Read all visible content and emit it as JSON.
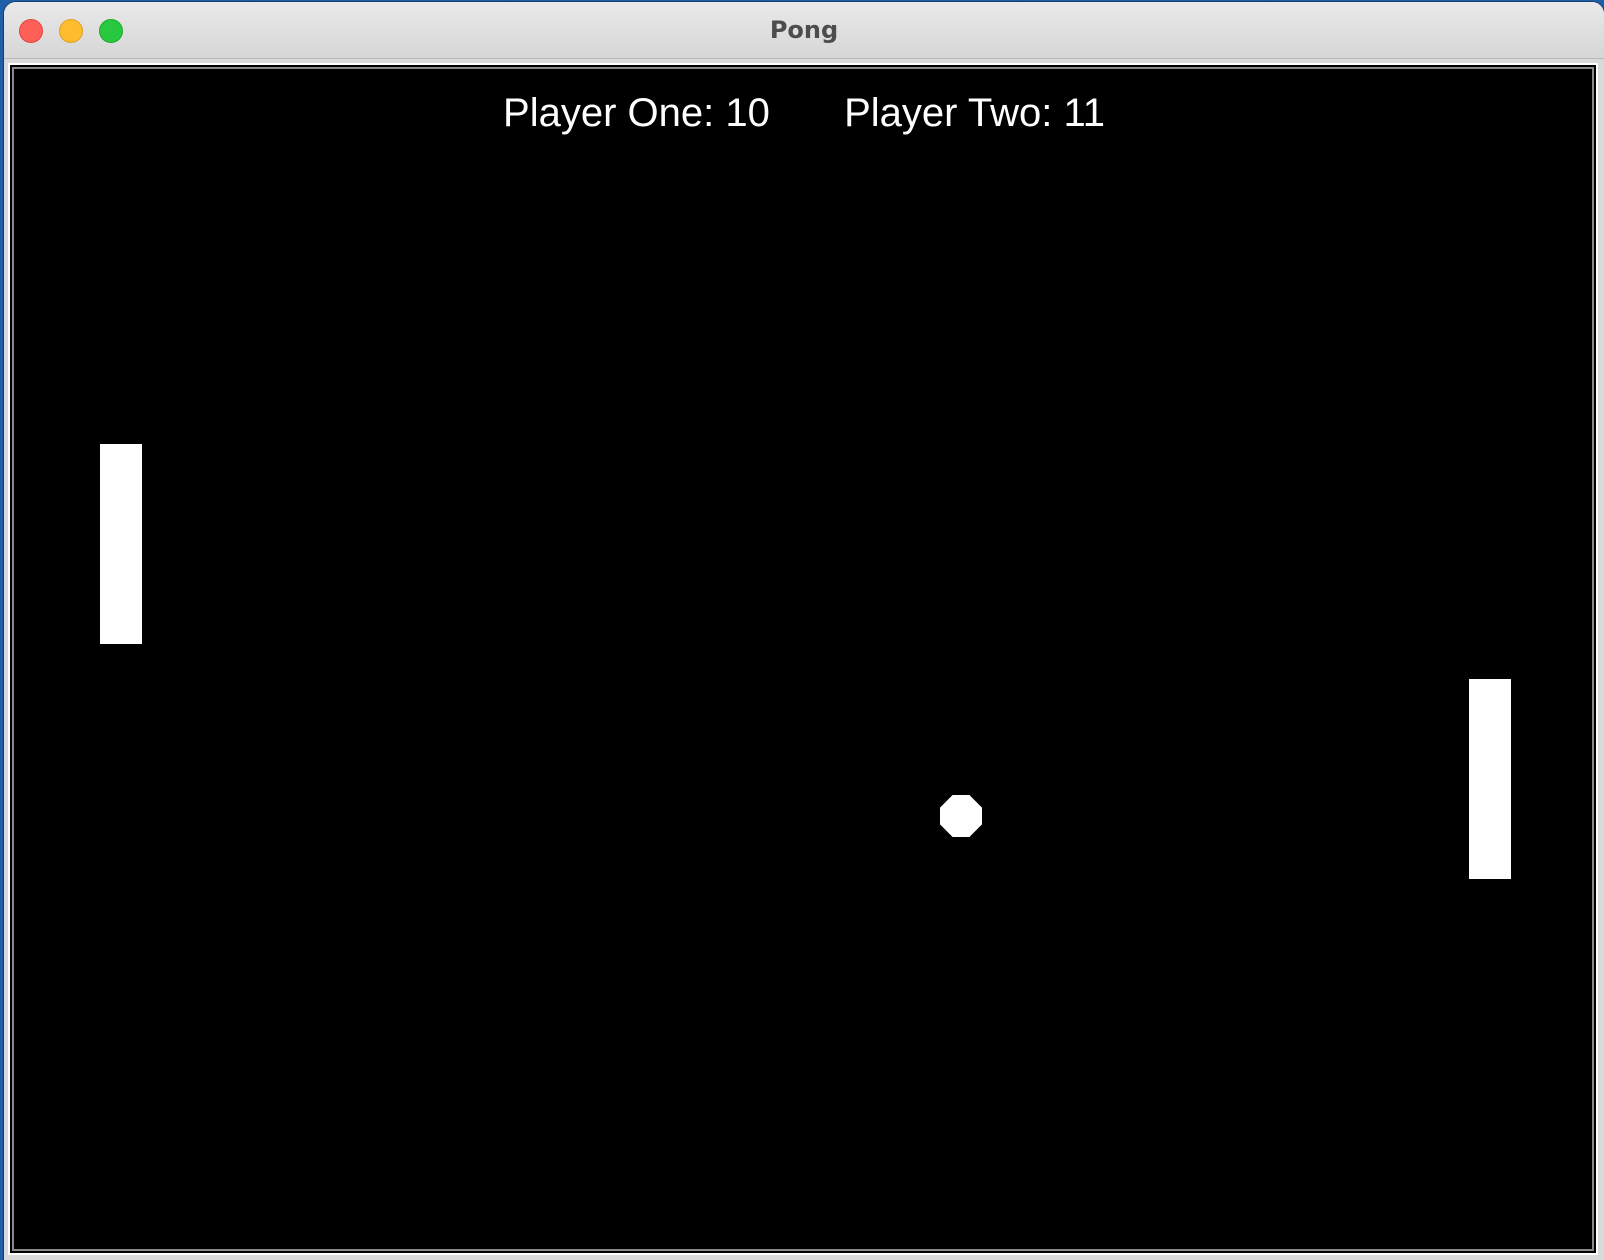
{
  "window": {
    "title": "Pong",
    "controls": [
      {
        "name": "close",
        "color": "#fe5f57"
      },
      {
        "name": "minimize",
        "color": "#febc2e"
      },
      {
        "name": "maximize",
        "color": "#28c840"
      }
    ]
  },
  "game": {
    "background_color": "#000000",
    "foreground_color": "#ffffff",
    "scores": {
      "player_one_text": "Player One: 10",
      "player_two_text": "Player Two: 11"
    }
  }
}
